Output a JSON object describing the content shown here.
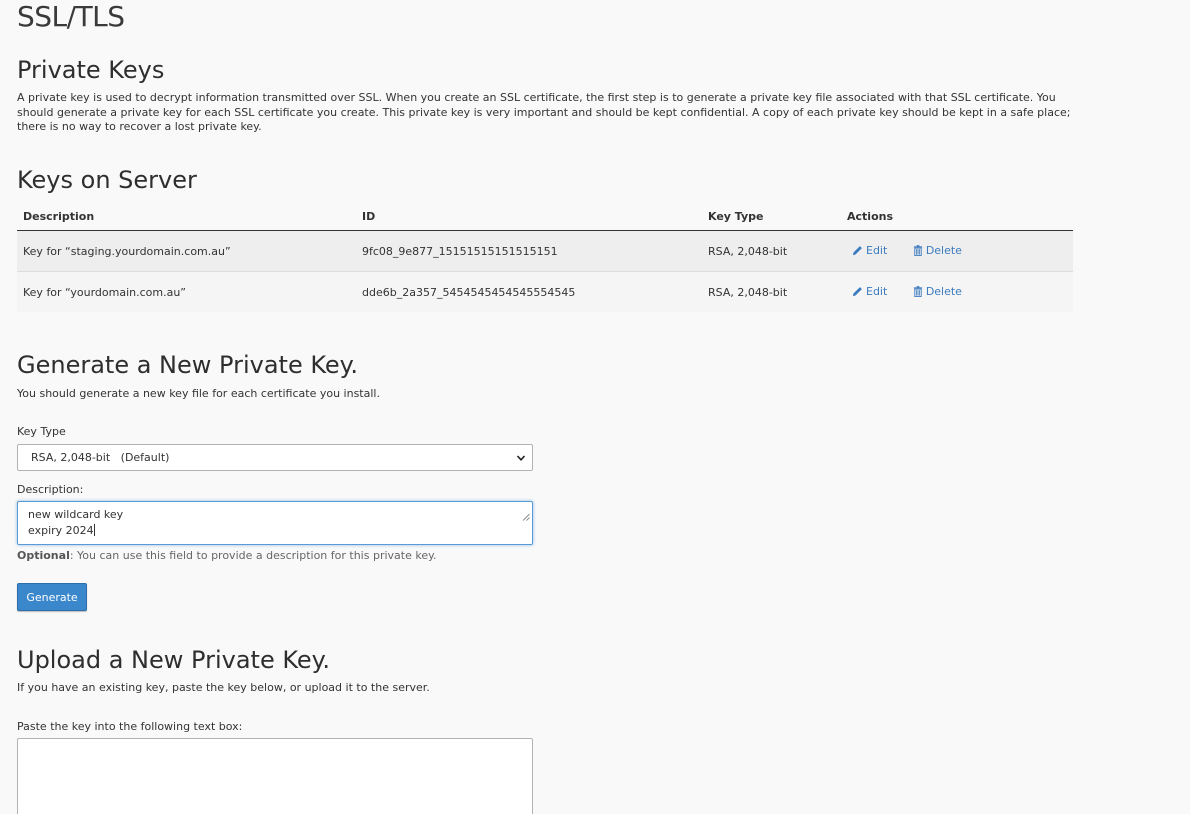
{
  "page": {
    "title": "SSL/TLS"
  },
  "private_keys": {
    "heading": "Private Keys",
    "description": "A private key is used to decrypt information transmitted over SSL. When you create an SSL certificate, the first step is to generate a private key file associated with that SSL certificate. You should generate a private key for each SSL certificate you create. This private key is very important and should be kept confidential. A copy of each private key should be kept in a safe place; there is no way to recover a lost private key."
  },
  "keys_on_server": {
    "heading": "Keys on Server",
    "columns": {
      "description": "Description",
      "id": "ID",
      "key_type": "Key Type",
      "actions": "Actions"
    },
    "rows": [
      {
        "description": "Key for “staging.yourdomain.com.au”",
        "id": "9fc08_9e877_15151515151515151",
        "key_type": "RSA, 2,048-bit",
        "edit_label": "Edit",
        "delete_label": "Delete"
      },
      {
        "description": "Key for “yourdomain.com.au”",
        "id": "dde6b_2a357_5454545454545554545",
        "key_type": "RSA, 2,048-bit",
        "edit_label": "Edit",
        "delete_label": "Delete"
      }
    ]
  },
  "generate": {
    "heading": "Generate a New Private Key.",
    "subtext": "You should generate a new key file for each certificate you install.",
    "key_type_label": "Key Type",
    "key_type_selected": "RSA, 2,048-bit   (Default)",
    "description_label": "Description:",
    "description_value": "new wildcard key\nexpiry 2024",
    "optional_label": "Optional",
    "optional_text": ": You can use this field to provide a description for this private key.",
    "button_label": "Generate"
  },
  "upload": {
    "heading": "Upload a New Private Key.",
    "subtext": "If you have an existing key, paste the key below, or upload it to the server.",
    "paste_label": "Paste the key into the following text box:",
    "paste_value": ""
  },
  "icons": {
    "edit": "pencil-icon",
    "delete": "trash-icon",
    "select_arrow": "chevron-down-icon"
  },
  "colors": {
    "link": "#3b7bbf",
    "primary_button": "#3a87cc",
    "focus_border": "#5b9bd5"
  }
}
